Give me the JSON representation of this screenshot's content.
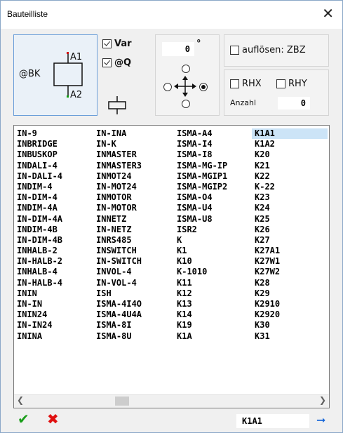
{
  "window": {
    "title": "Bauteilliste",
    "close_glyph": "✕"
  },
  "symbol": {
    "name": "@BK",
    "pin_top": "A1",
    "pin_bottom": "A2"
  },
  "options": {
    "var_label": "Var",
    "var_checked": true,
    "q_label": "@Q",
    "q_checked": true
  },
  "rotation": {
    "value": "0",
    "unit": "°"
  },
  "resolve": {
    "label": "auflösen: ZBZ",
    "checked": false
  },
  "mirror": {
    "rhx_label": "RHX",
    "rhx_checked": false,
    "rhy_label": "RHY",
    "rhy_checked": false,
    "count_label": "Anzahl",
    "count_value": "0"
  },
  "list": {
    "columns": [
      [
        "IN-9",
        "INBRIDGE",
        "INBUSKOP",
        "INDALI-4",
        "IN-DALI-4",
        "INDIM-4",
        "IN-DIM-4",
        "INDIM-4A",
        "IN-DIM-4A",
        "INDIM-4B",
        "IN-DIM-4B",
        "INHALB-2",
        "IN-HALB-2",
        "INHALB-4",
        "IN-HALB-4",
        "ININ",
        "IN-IN",
        "ININ24",
        "IN-IN24",
        "ININA"
      ],
      [
        "IN-INA",
        "IN-K",
        "INMASTER",
        "INMASTER3",
        "INMOT24",
        "IN-MOT24",
        "INMOTOR",
        "IN-MOTOR",
        "INNETZ",
        "IN-NETZ",
        "INRS485",
        "INSWITCH",
        "IN-SWITCH",
        "INVOL-4",
        "IN-VOL-4",
        "ISH",
        "ISMA-4I4O",
        "ISMA-4U4A",
        "ISMA-8I",
        "ISMA-8U"
      ],
      [
        "ISMA-A4",
        "ISMA-I4",
        "ISMA-I8",
        "ISMA-MG-IP",
        "ISMA-MGIP1",
        "ISMA-MGIP2",
        "ISMA-O4",
        "ISMA-U4",
        "ISMA-U8",
        "ISR2",
        "K",
        "K1",
        "K10",
        "K-1010",
        "K11",
        "K12",
        "K13",
        "K14",
        "K19",
        "K1A"
      ],
      [
        "K1A1",
        "K1A2",
        "K20",
        "K21",
        "K22",
        "K-22",
        "K23",
        "K24",
        "K25",
        "K26",
        "K27",
        "K27A1",
        "K27W1",
        "K27W2",
        "K28",
        "K29",
        "K2910",
        "K2920",
        "K30",
        "K31"
      ]
    ],
    "selected": "K1A1"
  },
  "footer": {
    "ok_glyph": "✔",
    "cancel_glyph": "✖",
    "current_value": "K1A1",
    "go_glyph": "➞"
  },
  "colors": {
    "ok": "#1a9e1a",
    "cancel": "#e01010",
    "go": "#1565d8",
    "selection": "#cce4f7"
  }
}
